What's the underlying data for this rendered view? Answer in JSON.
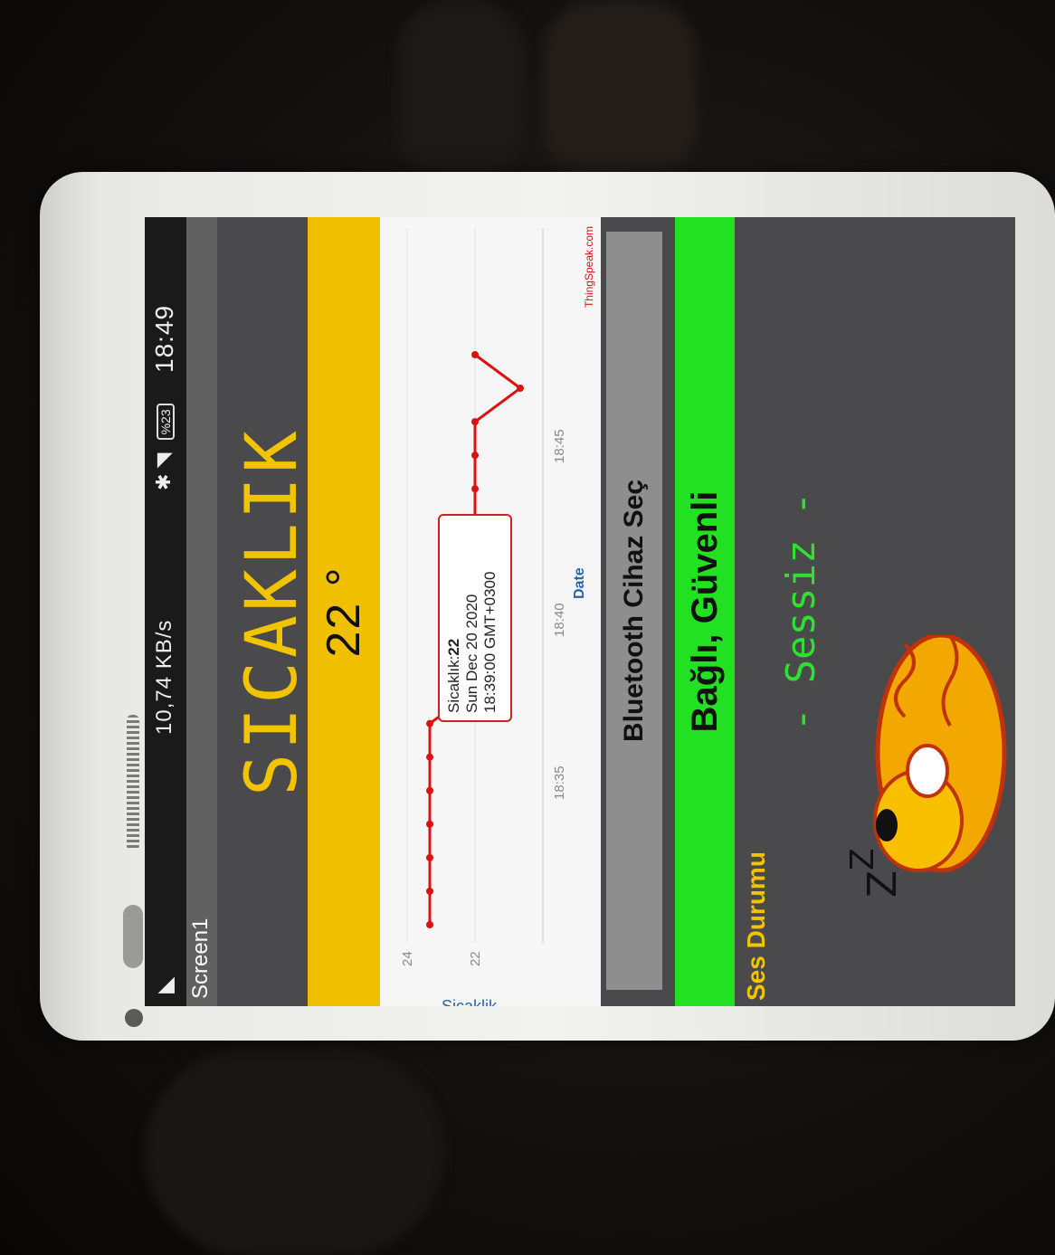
{
  "status_bar": {
    "speed": "10,74 KB/s",
    "battery": "%23",
    "time": "18:49"
  },
  "app": {
    "screen_name": "Screen1"
  },
  "sensor": {
    "title": "SICAKLIK",
    "value": "22 °"
  },
  "chart": {
    "field_label": "Sicaklik",
    "brand": "ThingSpeak.com",
    "x_axis_label": "Date",
    "y_ticks": [
      "24",
      "22"
    ],
    "x_ticks": [
      "18:35",
      "18:40",
      "18:45"
    ],
    "tooltip": {
      "field": "Sicaklık:",
      "value": "22",
      "date": "Sun Dec 20 2020",
      "time": "18:39:00 GMT+0300"
    }
  },
  "chart_data": {
    "type": "line",
    "series": [
      {
        "name": "Sicaklik",
        "x": [
          "18:32",
          "18:33",
          "18:34",
          "18:35",
          "18:36",
          "18:37",
          "18:38",
          "18:39",
          "18:40",
          "18:41",
          "18:42",
          "18:43",
          "18:44",
          "18:45",
          "18:46",
          "18:47",
          "18:48",
          "18:49"
        ],
        "values": [
          24,
          24,
          24,
          24,
          24,
          24,
          24,
          22,
          22,
          22,
          22,
          22,
          22,
          22,
          22,
          22,
          20,
          22
        ]
      }
    ],
    "x_ticks": [
      "18:35",
      "18:40",
      "18:45"
    ],
    "y_ticks": [
      "24",
      "22"
    ],
    "xlabel": "Date",
    "ylabel": "Sicaklik",
    "ylim": [
      19,
      25
    ],
    "color": "#dd1111"
  },
  "bluetooth": {
    "label": "Bluetooth Cihaz Seç"
  },
  "connection": {
    "status": "Bağlı, Güvenli",
    "color": "#22e022"
  },
  "sound": {
    "label": "Ses Durumu",
    "status": "- Sessiz -"
  },
  "colors": {
    "accent": "#f0c000",
    "status_green": "#22e022",
    "line": "#dd1111"
  }
}
